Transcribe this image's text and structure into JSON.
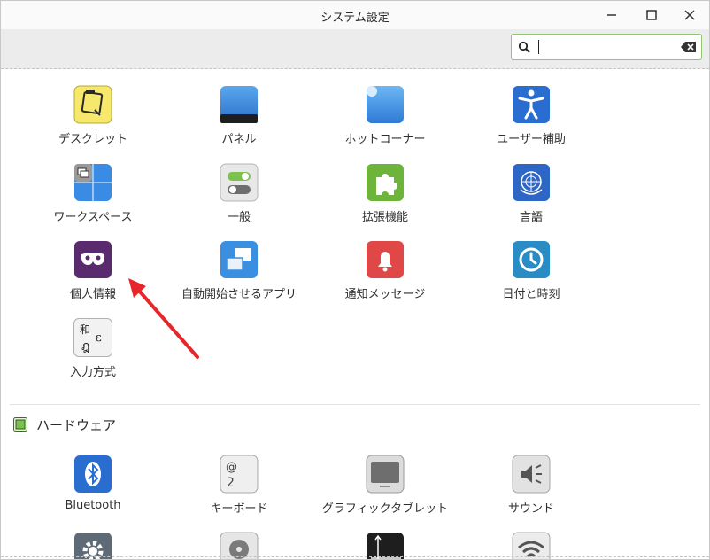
{
  "window": {
    "title": "システム設定"
  },
  "search": {
    "value": ""
  },
  "section1": {
    "items": [
      {
        "label": "デスクレット",
        "icon": "desklets-icon"
      },
      {
        "label": "パネル",
        "icon": "panel-icon"
      },
      {
        "label": "ホットコーナー",
        "icon": "hot-corners-icon"
      },
      {
        "label": "ユーザー補助",
        "icon": "accessibility-icon"
      },
      {
        "label": "ワークスペース",
        "icon": "workspaces-icon"
      },
      {
        "label": "一般",
        "icon": "general-icon"
      },
      {
        "label": "拡張機能",
        "icon": "extensions-icon"
      },
      {
        "label": "言語",
        "icon": "languages-icon"
      },
      {
        "label": "個人情報",
        "icon": "privacy-icon"
      },
      {
        "label": "自動開始させるアプリ",
        "icon": "startup-apps-icon"
      },
      {
        "label": "通知メッセージ",
        "icon": "notifications-icon"
      },
      {
        "label": "日付と時刻",
        "icon": "date-time-icon"
      },
      {
        "label": "入力方式",
        "icon": "input-method-icon"
      }
    ]
  },
  "section2": {
    "title": "ハードウェア",
    "icon": "hardware-chip-icon",
    "items": [
      {
        "label": "Bluetooth",
        "icon": "bluetooth-icon"
      },
      {
        "label": "キーボード",
        "icon": "keyboard-icon"
      },
      {
        "label": "グラフィックタブレット",
        "icon": "graphics-tablet-icon"
      },
      {
        "label": "サウンド",
        "icon": "sound-icon"
      }
    ]
  },
  "input_icon": {
    "kanji": "和",
    "thai": "ฎ",
    "other": "ε"
  },
  "colors": {
    "accent": "#8fc26a",
    "arrow": "#e8262a"
  }
}
